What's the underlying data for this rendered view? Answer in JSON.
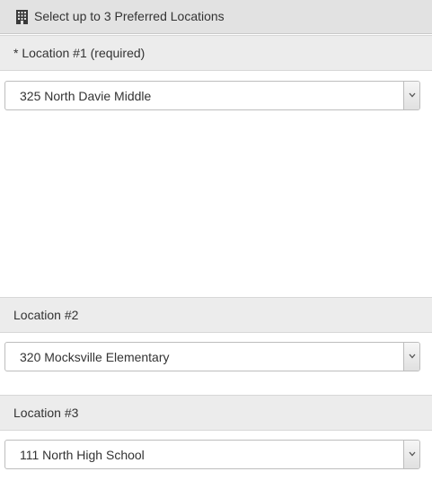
{
  "header": {
    "icon": "building-icon",
    "title": "Select up to 3 Preferred Locations"
  },
  "locations": [
    {
      "label": "* Location #1 (required)",
      "selected": "325 North Davie Middle"
    },
    {
      "label": "Location #2",
      "selected": "320 Mocksville Elementary"
    },
    {
      "label": "Location #3",
      "selected": "111 North High School"
    }
  ],
  "colors": {
    "title_bar": "#e2e2e2",
    "section_header": "#ececec",
    "border": "#bdbdbd",
    "text": "#333333"
  }
}
